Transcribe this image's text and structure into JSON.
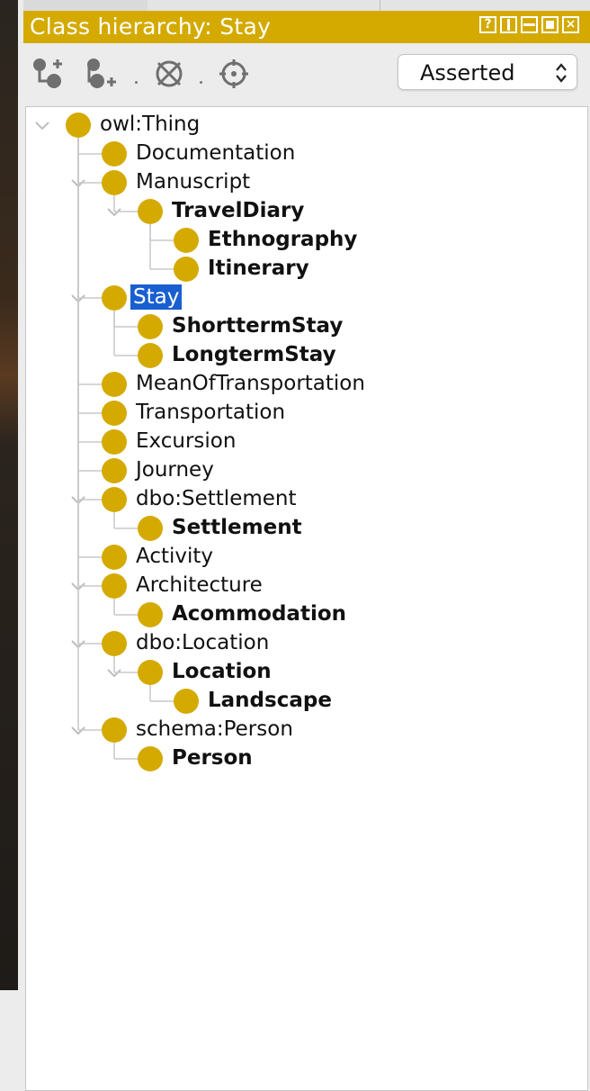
{
  "panel": {
    "title": "Class hierarchy: Stay",
    "window_buttons": [
      "help-icon",
      "split-columns-icon",
      "split-rows-icon",
      "maximize-icon",
      "close-icon"
    ]
  },
  "toolbar": {
    "tools": [
      "add-subclass-icon",
      "add-sibling-class-icon",
      "delete-class-icon",
      "find-class-icon"
    ],
    "view_mode": {
      "selected": "Asserted"
    }
  },
  "tree": {
    "root": "owl:Thing",
    "nodes": [
      {
        "label": "owl:Thing",
        "level": 0,
        "expanded": true,
        "bold": false
      },
      {
        "label": "Documentation",
        "level": 1,
        "bold": false
      },
      {
        "label": "Manuscript",
        "level": 1,
        "expanded": true,
        "bold": false
      },
      {
        "label": "TravelDiary",
        "level": 2,
        "expanded": true,
        "bold": true
      },
      {
        "label": "Ethnography",
        "level": 3,
        "bold": true
      },
      {
        "label": "Itinerary",
        "level": 3,
        "bold": true
      },
      {
        "label": "Stay",
        "level": 1,
        "expanded": true,
        "bold": false,
        "selected": true
      },
      {
        "label": "ShorttermStay",
        "level": 2,
        "bold": true
      },
      {
        "label": "LongtermStay",
        "level": 2,
        "bold": true
      },
      {
        "label": "MeanOfTransportation",
        "level": 1,
        "bold": false
      },
      {
        "label": "Transportation",
        "level": 1,
        "bold": false
      },
      {
        "label": "Excursion",
        "level": 1,
        "bold": false
      },
      {
        "label": "Journey",
        "level": 1,
        "bold": false
      },
      {
        "label": "dbo:Settlement",
        "level": 1,
        "expanded": true,
        "bold": false
      },
      {
        "label": "Settlement",
        "level": 2,
        "bold": true
      },
      {
        "label": "Activity",
        "level": 1,
        "bold": false
      },
      {
        "label": "Architecture",
        "level": 1,
        "expanded": true,
        "bold": false
      },
      {
        "label": "Acommodation",
        "level": 2,
        "bold": true
      },
      {
        "label": "dbo:Location",
        "level": 1,
        "expanded": true,
        "bold": false
      },
      {
        "label": "Location",
        "level": 2,
        "expanded": true,
        "bold": true
      },
      {
        "label": "Landscape",
        "level": 3,
        "bold": true
      },
      {
        "label": "schema:Person",
        "level": 1,
        "expanded": true,
        "bold": false
      },
      {
        "label": "Person",
        "level": 2,
        "bold": true
      }
    ]
  },
  "colors": {
    "accent": "#d4aa00",
    "selection": "#1a5fd0",
    "title_text": "#ffffff"
  }
}
